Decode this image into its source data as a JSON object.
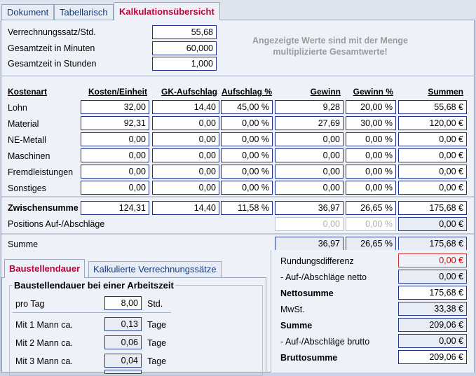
{
  "tabs": [
    "Dokument",
    "Tabellarisch",
    "Kalkulationsübersicht"
  ],
  "top": {
    "rate_label": "Verrechnungssatz/Std.",
    "rate_value": "55,68",
    "minutes_label": "Gesamtzeit in Minuten",
    "minutes_value": "60,000",
    "hours_label": "Gesamtzeit in Stunden",
    "hours_value": "1,000",
    "note_line1": "Angezeigte Werte sind mit der Menge",
    "note_line2": "multiplizierte Gesamtwerte!"
  },
  "headers": [
    "Kostenart",
    "Kosten/Einheit",
    "GK-Aufschlag",
    "Aufschlag %",
    "Gewinn",
    "Gewinn %",
    "Summen"
  ],
  "rows": [
    {
      "label": "Lohn",
      "cells": [
        "32,00",
        "14,40",
        "45,00 %",
        "9,28",
        "20,00 %",
        "55,68 €"
      ]
    },
    {
      "label": "Material",
      "cells": [
        "92,31",
        "0,00",
        "0,00 %",
        "27,69",
        "30,00 %",
        "120,00 €"
      ]
    },
    {
      "label": "NE-Metall",
      "cells": [
        "0,00",
        "0,00",
        "0,00 %",
        "0,00",
        "0,00 %",
        "0,00 €"
      ]
    },
    {
      "label": "Maschinen",
      "cells": [
        "0,00",
        "0,00",
        "0,00 %",
        "0,00",
        "0,00 %",
        "0,00 €"
      ]
    },
    {
      "label": "Fremdleistungen",
      "cells": [
        "0,00",
        "0,00",
        "0,00 %",
        "0,00",
        "0,00 %",
        "0,00 €"
      ]
    },
    {
      "label": "Sonstiges",
      "cells": [
        "0,00",
        "0,00",
        "0,00 %",
        "0,00",
        "0,00 %",
        "0,00 €"
      ]
    }
  ],
  "subtotal": {
    "label": "Zwischensumme",
    "cells": [
      "124,31",
      "14,40",
      "11,58 %",
      "36,97",
      "26,65 %",
      "175,68 €"
    ]
  },
  "positions": {
    "label": "Positions Auf-/Abschläge",
    "gewinn": "0,00",
    "gewinn_pct": "0,00 %",
    "summe": "0,00 €"
  },
  "summe": {
    "label": "Summe",
    "gewinn": "36,97",
    "gewinn_pct": "26,65 %",
    "summe": "175,68 €"
  },
  "subtabs": [
    "Baustellendauer",
    "Kalkulierte Verrechnungssätze"
  ],
  "duration": {
    "group_title": "Baustellendauer bei einer Arbeitszeit",
    "per_day_label": "pro Tag",
    "per_day_value": "8,00",
    "per_day_unit": "Std.",
    "rows": [
      {
        "label": "Mit 1 Mann ca.",
        "value": "0,13",
        "unit": "Tage"
      },
      {
        "label": "Mit 2 Mann ca.",
        "value": "0,06",
        "unit": "Tage"
      },
      {
        "label": "Mit 3 Mann ca.",
        "value": "0,04",
        "unit": "Tage"
      }
    ]
  },
  "totals": [
    {
      "label": "Rundungsdifferenz",
      "value": "0,00 €"
    },
    {
      "label": "- Auf-/Abschläge netto",
      "value": "0,00 €"
    },
    {
      "label": "Nettosumme",
      "value": "175,68 €"
    },
    {
      "label": "MwSt.",
      "value": "33,38 €"
    },
    {
      "label": "Summe",
      "value": "209,06 €"
    },
    {
      "label": "- Auf-/Abschläge brutto",
      "value": "0,00 €"
    },
    {
      "label": "Bruttosumme",
      "value": "209,06 €"
    }
  ],
  "colors": {
    "accent_tab": "#c0003c",
    "border": "#1d2f8a",
    "negative": "#e00000"
  }
}
